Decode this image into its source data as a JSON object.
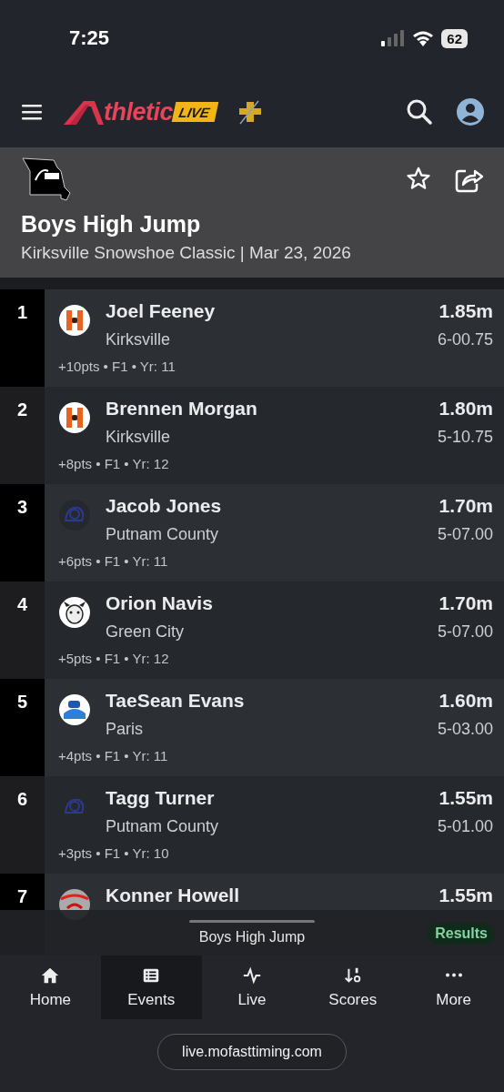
{
  "status_bar": {
    "time": "7:25",
    "battery": "62"
  },
  "header": {
    "logo_word": "thletic",
    "logo_badge": "LIVE"
  },
  "event": {
    "title": "Boys High Jump",
    "subtitle": "Kirksville Snowshoe Classic | Mar 23, 2026"
  },
  "results": [
    {
      "rank": "1",
      "name": "Joel Feeney",
      "school": "Kirksville",
      "mark": "1.85m",
      "imperial": "6-00.75",
      "meta": "+10pts • F1 • Yr: 11",
      "kind": "k"
    },
    {
      "rank": "2",
      "name": "Brennen Morgan",
      "school": "Kirksville",
      "mark": "1.80m",
      "imperial": "5-10.75",
      "meta": "+8pts • F1 • Yr: 12",
      "kind": "k"
    },
    {
      "rank": "3",
      "name": "Jacob Jones",
      "school": "Putnam County",
      "mark": "1.70m",
      "imperial": "5-07.00",
      "meta": "+6pts • F1 • Yr: 11",
      "kind": "pc"
    },
    {
      "rank": "4",
      "name": "Orion Navis",
      "school": "Green City",
      "mark": "1.70m",
      "imperial": "5-07.00",
      "meta": "+5pts • F1 • Yr: 12",
      "kind": "gc"
    },
    {
      "rank": "5",
      "name": "TaeSean Evans",
      "school": "Paris",
      "mark": "1.60m",
      "imperial": "5-03.00",
      "meta": "+4pts • F1 • Yr: 11",
      "kind": "p"
    },
    {
      "rank": "6",
      "name": "Tagg Turner",
      "school": "Putnam County",
      "mark": "1.55m",
      "imperial": "5-01.00",
      "meta": "+3pts • F1 • Yr: 10",
      "kind": "pc"
    },
    {
      "rank": "7",
      "name": "Konner Howell",
      "mark": "1.55m",
      "kind": "cc"
    }
  ],
  "mini_player": {
    "title": "Boys High Jump",
    "badge": "Results"
  },
  "bottom_nav": [
    {
      "label": "Home",
      "selected": false
    },
    {
      "label": "Events",
      "selected": true
    },
    {
      "label": "Live",
      "selected": false
    },
    {
      "label": "Scores",
      "selected": false
    },
    {
      "label": "More",
      "selected": false
    }
  ],
  "url": "live.mofasttiming.com"
}
